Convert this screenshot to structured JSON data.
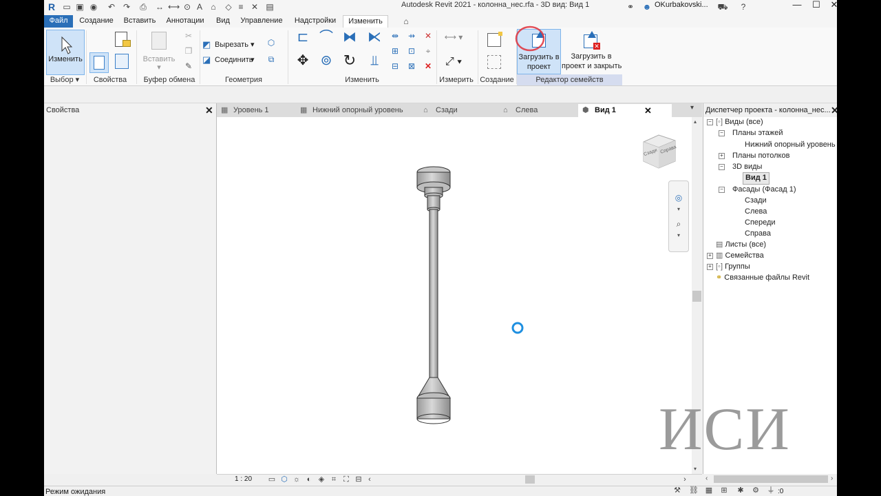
{
  "app": {
    "title": "Autodesk Revit 2021 - колонна_нес.rfa - 3D вид: Вид 1",
    "user": "OKurbakovski...",
    "logo": "R"
  },
  "menu_tabs": [
    "Файл",
    "Создание",
    "Вставить",
    "Аннотации",
    "Вид",
    "Управление",
    "Надстройки",
    "Изменить"
  ],
  "ribbon": {
    "modify_label": "Изменить",
    "paste_label": "Вставить",
    "cut_label": "Вырезать",
    "join_label": "Соединить",
    "load_label_1": "Загрузить в",
    "load_label_2": "проект",
    "load_close_label_1": "Загрузить в",
    "load_close_label_2": "проект и закрыть",
    "panels": {
      "select": "Выбор",
      "properties": "Свойства",
      "clipboard": "Буфер обмена",
      "geometry": "Геометрия",
      "modify": "Изменить",
      "measure": "Измерить",
      "create": "Создание",
      "family_editor": "Редактор семейств"
    }
  },
  "properties": {
    "title": "Свойства"
  },
  "view_tabs": [
    "Уровень 1",
    "Нижний опорный уровень",
    "Сзади",
    "Слева",
    "Вид 1"
  ],
  "view_cube": {
    "face1": "Сзади",
    "face2": "Справа"
  },
  "view_bar": {
    "scale": "1 : 20"
  },
  "project_browser": {
    "title": "Диспетчер проекта - колонна_нес...",
    "tree": [
      "Виды (все)",
      "Планы этажей",
      "Нижний опорный уровень",
      "Планы потолков",
      "3D виды",
      "Вид 1",
      "Фасады (Фасад 1)",
      "Сзади",
      "Слева",
      "Спереди",
      "Справа",
      "Листы (все)",
      "Семейства",
      "Группы",
      "Связанные файлы Revit"
    ]
  },
  "status": {
    "text": "Режим ожидания",
    "filter_count": ":0"
  },
  "watermark": "ИСИ",
  "colors": {
    "file_tab": "#2a6fb8",
    "accent": "#3a7fc8",
    "family_editor_panel": "#d5dcef",
    "highlight_circle": "#e0303a"
  }
}
